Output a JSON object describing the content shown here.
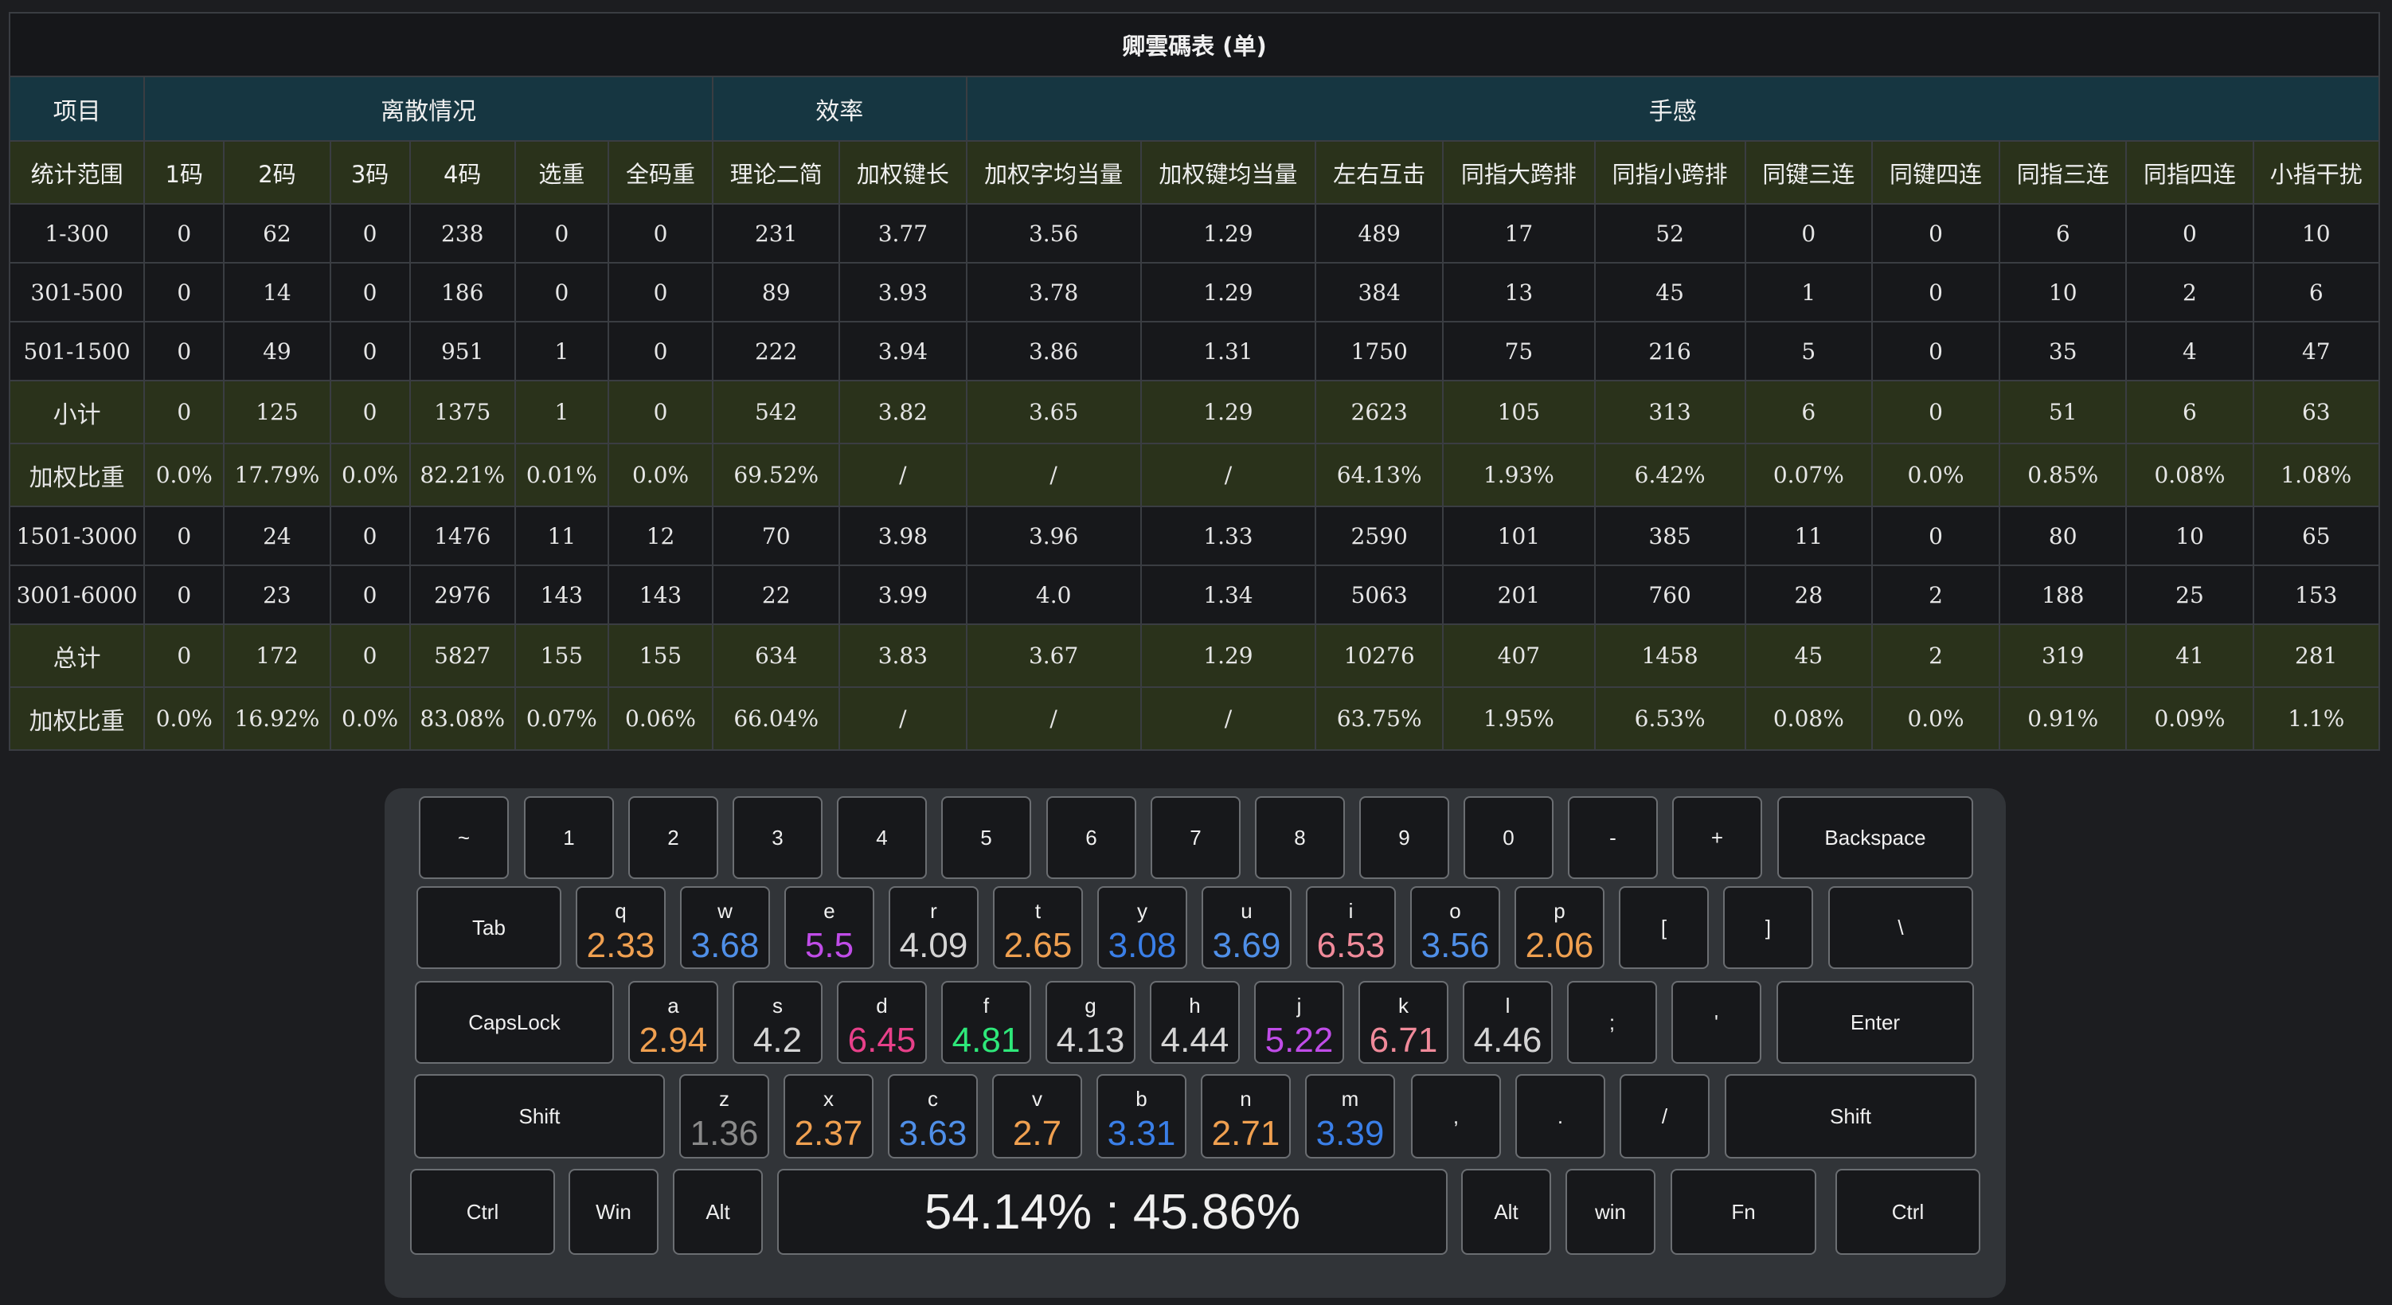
{
  "table": {
    "title": "卿雲碼表 (单)",
    "groups": [
      "项目",
      "离散情况",
      "效率",
      "手感"
    ],
    "columns": [
      "统计范围",
      "1码",
      "2码",
      "3码",
      "4码",
      "选重",
      "全码重",
      "理论二简",
      "加权键长",
      "加权字均当量",
      "加权键均当量",
      "左右互击",
      "同指大跨排",
      "同指小跨排",
      "同键三连",
      "同键四连",
      "同指三连",
      "同指四连",
      "小指干扰"
    ],
    "rows": [
      {
        "type": "data",
        "cells": [
          "1-300",
          "0",
          "62",
          "0",
          "238",
          "0",
          "0",
          "231",
          "3.77",
          "3.56",
          "1.29",
          "489",
          "17",
          "52",
          "0",
          "0",
          "6",
          "0",
          "10"
        ]
      },
      {
        "type": "data",
        "cells": [
          "301-500",
          "0",
          "14",
          "0",
          "186",
          "0",
          "0",
          "89",
          "3.93",
          "3.78",
          "1.29",
          "384",
          "13",
          "45",
          "1",
          "0",
          "10",
          "2",
          "6"
        ]
      },
      {
        "type": "data",
        "cells": [
          "501-1500",
          "0",
          "49",
          "0",
          "951",
          "1",
          "0",
          "222",
          "3.94",
          "3.86",
          "1.31",
          "1750",
          "75",
          "216",
          "5",
          "0",
          "35",
          "4",
          "47"
        ]
      },
      {
        "type": "sub",
        "cells": [
          "小计",
          "0",
          "125",
          "0",
          "1375",
          "1",
          "0",
          "542",
          "3.82",
          "3.65",
          "1.29",
          "2623",
          "105",
          "313",
          "6",
          "0",
          "51",
          "6",
          "63"
        ]
      },
      {
        "type": "sub",
        "cells": [
          "加权比重",
          "0.0%",
          "17.79%",
          "0.0%",
          "82.21%",
          "0.01%",
          "0.0%",
          "69.52%",
          "/",
          "/",
          "/",
          "64.13%",
          "1.93%",
          "6.42%",
          "0.07%",
          "0.0%",
          "0.85%",
          "0.08%",
          "1.08%"
        ]
      },
      {
        "type": "data",
        "cells": [
          "1501-3000",
          "0",
          "24",
          "0",
          "1476",
          "11",
          "12",
          "70",
          "3.98",
          "3.96",
          "1.33",
          "2590",
          "101",
          "385",
          "11",
          "0",
          "80",
          "10",
          "65"
        ]
      },
      {
        "type": "data",
        "cells": [
          "3001-6000",
          "0",
          "23",
          "0",
          "2976",
          "143",
          "143",
          "22",
          "3.99",
          "4.0",
          "1.34",
          "5063",
          "201",
          "760",
          "28",
          "2",
          "188",
          "25",
          "153"
        ]
      },
      {
        "type": "sub",
        "cells": [
          "总计",
          "0",
          "172",
          "0",
          "5827",
          "155",
          "155",
          "634",
          "3.83",
          "3.67",
          "1.29",
          "10276",
          "407",
          "1458",
          "45",
          "2",
          "319",
          "41",
          "281"
        ]
      },
      {
        "type": "sub",
        "cells": [
          "加权比重",
          "0.0%",
          "16.92%",
          "0.0%",
          "83.08%",
          "0.07%",
          "0.06%",
          "66.04%",
          "/",
          "/",
          "/",
          "63.75%",
          "1.95%",
          "6.53%",
          "0.08%",
          "0.0%",
          "0.91%",
          "0.09%",
          "1.1%"
        ]
      }
    ]
  },
  "keyboard": {
    "rows": [
      [
        {
          "label": "~"
        },
        {
          "label": "1"
        },
        {
          "label": "2"
        },
        {
          "label": "3"
        },
        {
          "label": "4"
        },
        {
          "label": "5"
        },
        {
          "label": "6"
        },
        {
          "label": "7"
        },
        {
          "label": "8"
        },
        {
          "label": "9"
        },
        {
          "label": "0"
        },
        {
          "label": "-"
        },
        {
          "label": "+"
        },
        {
          "label": "Backspace"
        }
      ],
      [
        {
          "label": "Tab"
        },
        {
          "label": "q",
          "value": "2.33",
          "color": "#f0a050"
        },
        {
          "label": "w",
          "value": "3.68",
          "color": "#4f8fe8"
        },
        {
          "label": "e",
          "value": "5.5",
          "color": "#c04ce8"
        },
        {
          "label": "r",
          "value": "4.09",
          "color": "#d4d4d4"
        },
        {
          "label": "t",
          "value": "2.65",
          "color": "#f0a050"
        },
        {
          "label": "y",
          "value": "3.08",
          "color": "#3a7fe8"
        },
        {
          "label": "u",
          "value": "3.69",
          "color": "#4f8fe8"
        },
        {
          "label": "i",
          "value": "6.53",
          "color": "#f08a9a"
        },
        {
          "label": "o",
          "value": "3.56",
          "color": "#4f8fe8"
        },
        {
          "label": "p",
          "value": "2.06",
          "color": "#f0a050"
        },
        {
          "label": "["
        },
        {
          "label": "]"
        },
        {
          "label": "\\"
        }
      ],
      [
        {
          "label": "CapsLock"
        },
        {
          "label": "a",
          "value": "2.94",
          "color": "#f0a050"
        },
        {
          "label": "s",
          "value": "4.2",
          "color": "#d4d4d4"
        },
        {
          "label": "d",
          "value": "6.45",
          "color": "#e8408a"
        },
        {
          "label": "f",
          "value": "4.81",
          "color": "#2ee87a"
        },
        {
          "label": "g",
          "value": "4.13",
          "color": "#d4d4d4"
        },
        {
          "label": "h",
          "value": "4.44",
          "color": "#d4d4d4"
        },
        {
          "label": "j",
          "value": "5.22",
          "color": "#c04ce8"
        },
        {
          "label": "k",
          "value": "6.71",
          "color": "#f08a9a"
        },
        {
          "label": "l",
          "value": "4.46",
          "color": "#d4d4d4"
        },
        {
          "label": ";"
        },
        {
          "label": "'"
        },
        {
          "label": "Enter"
        }
      ],
      [
        {
          "label": "Shift"
        },
        {
          "label": "z",
          "value": "1.36",
          "color": "#8a8a8a"
        },
        {
          "label": "x",
          "value": "2.37",
          "color": "#f0a050"
        },
        {
          "label": "c",
          "value": "3.63",
          "color": "#4f8fe8"
        },
        {
          "label": "v",
          "value": "2.7",
          "color": "#f0a050"
        },
        {
          "label": "b",
          "value": "3.31",
          "color": "#3a7fe8"
        },
        {
          "label": "n",
          "value": "2.71",
          "color": "#f0a050"
        },
        {
          "label": "m",
          "value": "3.39",
          "color": "#3a7fe8"
        },
        {
          "label": ","
        },
        {
          "label": "."
        },
        {
          "label": "/"
        },
        {
          "label": "Shift"
        }
      ],
      [
        {
          "label": "Ctrl"
        },
        {
          "label": "Win"
        },
        {
          "label": "Alt"
        },
        {
          "label": "54.14% : 45.86%"
        },
        {
          "label": "Alt"
        },
        {
          "label": "win"
        },
        {
          "label": "Fn"
        },
        {
          "label": "Ctrl"
        }
      ]
    ]
  }
}
